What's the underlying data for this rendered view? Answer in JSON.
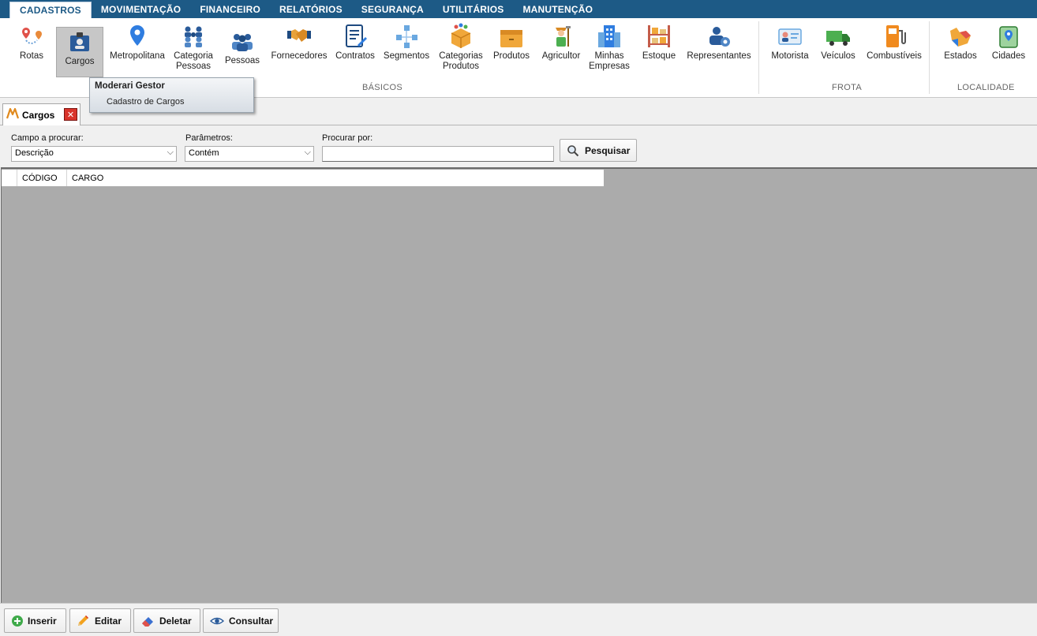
{
  "menu": {
    "tabs": [
      {
        "label": "CADASTROS"
      },
      {
        "label": "MOVIMENTAÇÃO"
      },
      {
        "label": "FINANCEIRO"
      },
      {
        "label": "RELATÓRIOS"
      },
      {
        "label": "SEGURANÇA"
      },
      {
        "label": "UTILITÁRIOS"
      },
      {
        "label": "MANUTENÇÃO"
      }
    ]
  },
  "ribbon": {
    "basicos": {
      "label": "BÁSICOS",
      "rotas": "Rotas",
      "cargos": "Cargos",
      "metropolitana": "Metropolitana",
      "categoria_pessoas_1": "Categoria",
      "categoria_pessoas_2": "Pessoas",
      "pessoas": "Pessoas",
      "fornecedores": "Fornecedores",
      "contratos": "Contratos",
      "segmentos": "Segmentos",
      "categorias_produtos_1": "Categorias",
      "categorias_produtos_2": "Produtos",
      "produtos": "Produtos",
      "agricultor": "Agricultor",
      "minhas_empresas_1": "Minhas",
      "minhas_empresas_2": "Empresas",
      "estoque": "Estoque",
      "representantes": "Representantes"
    },
    "frota": {
      "label": "FROTA",
      "motorista": "Motorista",
      "veiculos": "Veículos",
      "combustiveis": "Combustíveis"
    },
    "localidade": {
      "label": "LOCALIDADE",
      "estados": "Estados",
      "cidades": "Cidades"
    }
  },
  "popup": {
    "title": "Moderari Gestor",
    "subtitle": "Cadastro de Cargos"
  },
  "doc_tab": {
    "label": "Cargos",
    "close": "✕"
  },
  "search": {
    "campo_label": "Campo a procurar:",
    "campo_value": "Descrição",
    "param_label": "Parâmetros:",
    "param_value": "Contém",
    "procurar_label": "Procurar por:",
    "procurar_value": "",
    "button": "Pesquisar"
  },
  "grid": {
    "columns": [
      "CÓDIGO",
      "CARGO"
    ],
    "rows": []
  },
  "toolbar": {
    "inserir": "Inserir",
    "editar": "Editar",
    "deletar": "Deletar",
    "consultar": "Consultar"
  },
  "colors": {
    "menubar": "#1d5a86",
    "grid_bg": "#ababab",
    "close_red": "#d9342b"
  }
}
